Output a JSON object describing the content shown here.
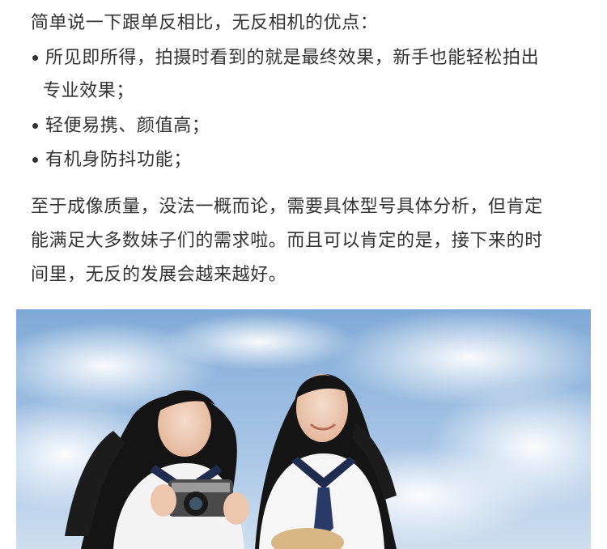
{
  "intro": "简单说一下跟单反相比，无反相机的优点：",
  "bullets": [
    {
      "line1": "所见即所得，拍摄时看到的就是最终效果，新手也能轻松拍出",
      "line2": "专业效果；"
    },
    {
      "line1": "轻便易携、颜值高；"
    },
    {
      "line1": "有机身防抖功能；"
    }
  ],
  "paragraph": [
    "至于成像质量，没法一概而论，需要具体型号具体分析，但肯定",
    "能满足大多数妹子们的需求啦。而且可以肯定的是，接下来的时",
    "间里，无反的发展会越来越好。"
  ],
  "image": {
    "subject": "two-girls-with-camera-photo",
    "sky_color": "#8fb6dc"
  }
}
